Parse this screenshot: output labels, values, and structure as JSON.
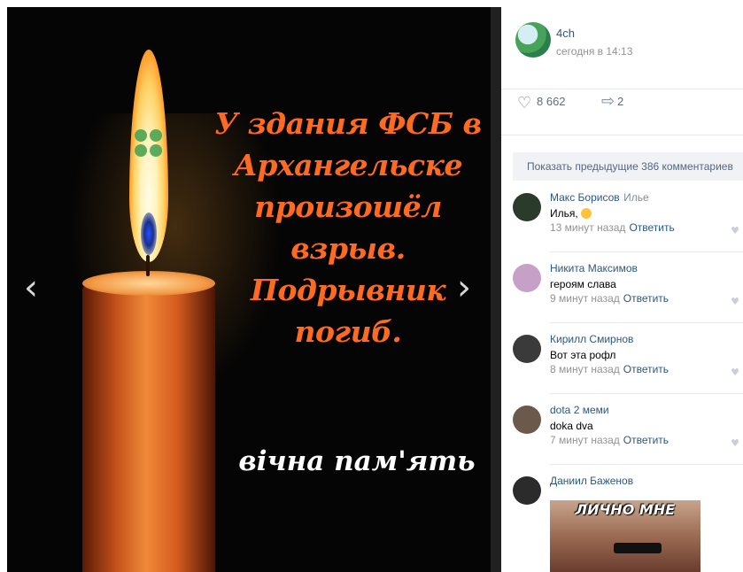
{
  "photo": {
    "headline": "У здания ФСБ в Архангельске произошёл взрыв. Подрывник погиб.",
    "memorial_text": "вічна пам'ять"
  },
  "post": {
    "group_name": "4ch",
    "time": "сегодня в 14:13",
    "likes": "8 662",
    "shares": "2"
  },
  "comments_section": {
    "show_previous": "Показать предыдущие 386 комментариев",
    "comments": [
      {
        "author": "Макс Борисов",
        "reply_to": "Илье",
        "text": "Илья,",
        "ago": "13 минут назад",
        "reply": "Ответить"
      },
      {
        "author": "Никита Максимов",
        "reply_to": "",
        "text": "героям слава",
        "ago": "9 минут назад",
        "reply": "Ответить"
      },
      {
        "author": "Кирилл Смирнов",
        "reply_to": "",
        "text": "Вот эта рофл",
        "ago": "8 минут назад",
        "reply": "Ответить"
      },
      {
        "author": "dota 2 меми",
        "reply_to": "",
        "text": "doka dva",
        "ago": "7 минут назад",
        "reply": "Ответить"
      },
      {
        "author": "Даниил Баженов",
        "reply_to": "",
        "text": "",
        "ago": "",
        "reply": ""
      }
    ],
    "meme_caption": "ЛИЧНО МНЕ"
  },
  "icons": {
    "prev": "chevron-left-icon",
    "next": "chevron-right-icon",
    "like": "heart-icon",
    "share": "share-icon"
  },
  "colors": {
    "headline": "#ff6a22",
    "link": "#2a5885",
    "muted": "#939393"
  }
}
